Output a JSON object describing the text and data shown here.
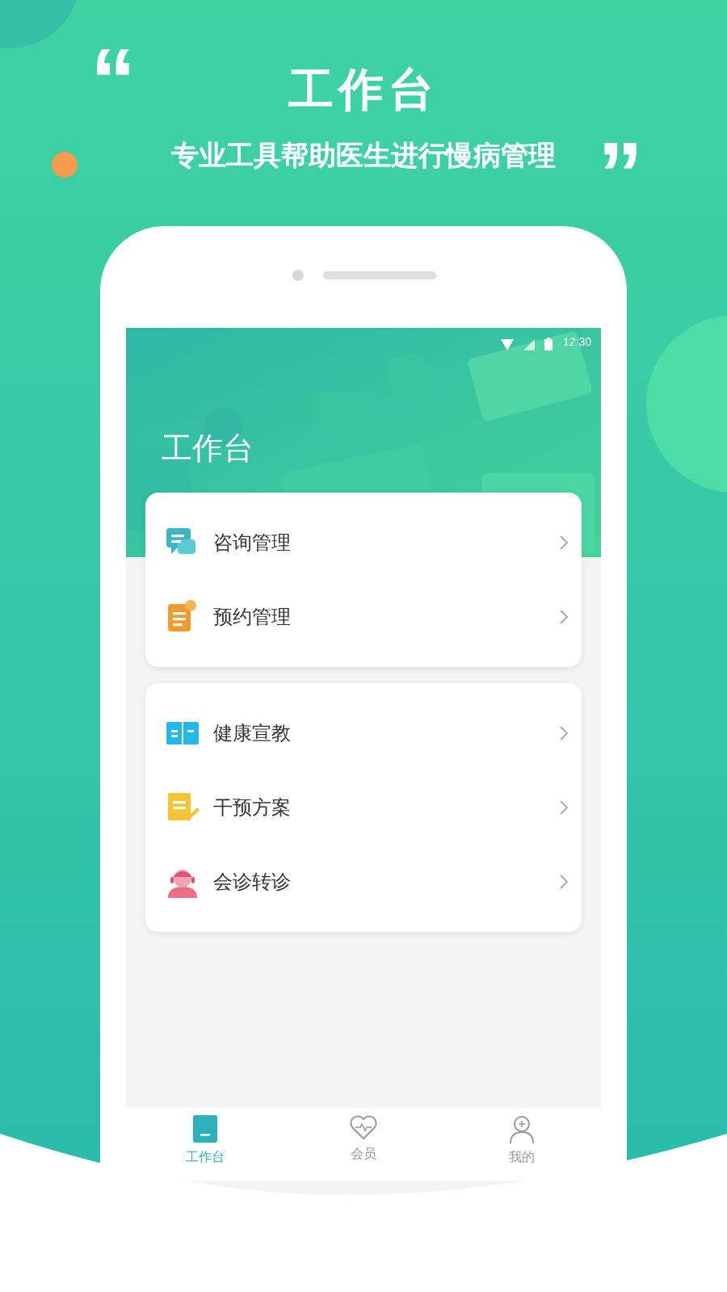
{
  "banner": {
    "open_quote": "“",
    "title": "工作台",
    "subtitle": "专业工具帮助医生进行慢病管理",
    "close_quote": "”"
  },
  "status_bar": {
    "time": "12:30"
  },
  "page_title": "工作台",
  "groups": [
    {
      "items": [
        {
          "label": "咨询管理",
          "kind": "chat"
        },
        {
          "label": "预约管理",
          "kind": "schedule"
        }
      ]
    },
    {
      "items": [
        {
          "label": "健康宣教",
          "kind": "book"
        },
        {
          "label": "干预方案",
          "kind": "note"
        },
        {
          "label": "会诊转诊",
          "kind": "doctor"
        }
      ]
    }
  ],
  "tabs": [
    {
      "label": "工作台",
      "kind": "desk",
      "selected": true
    },
    {
      "label": "会员",
      "kind": "heart",
      "selected": false
    },
    {
      "label": "我的",
      "kind": "person",
      "selected": false
    }
  ]
}
